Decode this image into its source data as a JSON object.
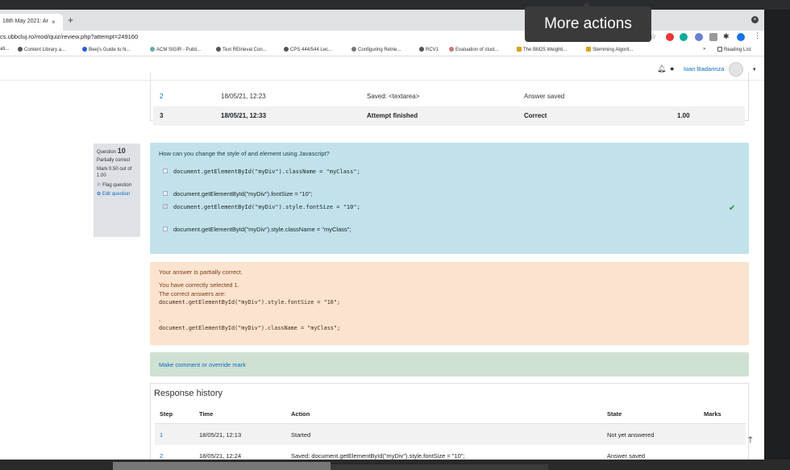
{
  "tooltip": {
    "text": "More actions"
  },
  "browser": {
    "tab_title": "18th May 2021: Ar",
    "tab_close": "×",
    "new_tab": "+",
    "url": "cs.ubbcluj.ro/mod/quiz/review.php?attempt=249160",
    "bookmarks": [
      "ati...",
      "Content Library a...",
      "Beej's Guide to N...",
      "ACM SIGIR - Publi...",
      "Text REtrieval Con...",
      "CPS 444/544 Lec...",
      "Configuring Retrie...",
      "RCV1",
      "Evaluation of clust...",
      "The BM25 Weighti...",
      "Stemming Algorit...",
      "»",
      "Reading List"
    ]
  },
  "user": {
    "name": "Ioan Badarinza"
  },
  "prev_history": {
    "rows": [
      {
        "step": "2",
        "time": "18/05/21, 12:23",
        "action": "Saved: <textarea>",
        "state": "Answer saved",
        "marks": ""
      },
      {
        "step": "3",
        "time": "18/05/21, 12:33",
        "action": "Attempt finished",
        "state": "Correct",
        "marks": "1.00"
      }
    ]
  },
  "question": {
    "label": "Question",
    "number": "10",
    "status": "Partially correct",
    "mark": "Mark 0.50 out of 1.00",
    "flag": "Flag question",
    "edit": "Edit question",
    "text": "How can you change the style of and element using Javascript?",
    "options": [
      "document.getElementById(\"myDiv\").className = \"myClass\";",
      "document.getElementById(\"myDiv\").fontSize = \"10\";",
      "document.getElementById(\"myDiv\").style.fontSize = \"10\";",
      "document.getElementById(\"myDiv\").style.className = \"myClass\";"
    ]
  },
  "feedback": {
    "line1": "Your answer is partially correct.",
    "line2": "You have correctly selected 1.",
    "line3": "The correct answers are:",
    "code1": "document.getElementById(\"myDiv\").style.fontSize = \"10\";",
    "sep": ",",
    "code2": "document.getElementById(\"myDiv\").className = \"myClass\";"
  },
  "comment_link": "Make comment or override mark",
  "response_history": {
    "title": "Response history",
    "headers": [
      "Step",
      "Time",
      "Action",
      "State",
      "Marks"
    ],
    "rows": [
      {
        "step": "1",
        "time": "18/05/21, 12:13",
        "action": "Started",
        "state": "Not yet answered",
        "marks": ""
      },
      {
        "step": "2",
        "time": "18/05/21, 12:24",
        "action": "Saved: document.getElementById(\"myDiv\").style.fontSize = \"10\";",
        "state": "Answer saved",
        "marks": ""
      }
    ]
  },
  "colors": {
    "link": "#0f6cbf",
    "formulation_bg": "#c1e2ea",
    "feedback_bg": "#fbe3cf",
    "comment_bg": "#cfe1d3"
  }
}
